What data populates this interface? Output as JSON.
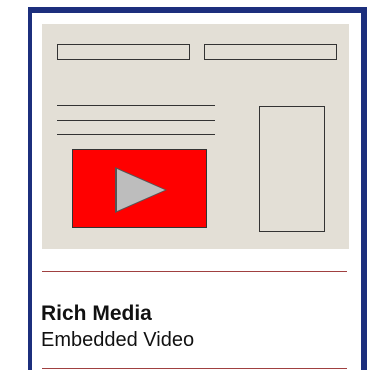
{
  "card": {
    "title": "Rich Media",
    "subtitle": "Embedded Video"
  },
  "illustration": {
    "icon": "play-icon",
    "video_color": "#ff0000",
    "background_color": "#e3dfd6",
    "frame_color": "#1c2f7d",
    "divider_color": "#a04040"
  }
}
